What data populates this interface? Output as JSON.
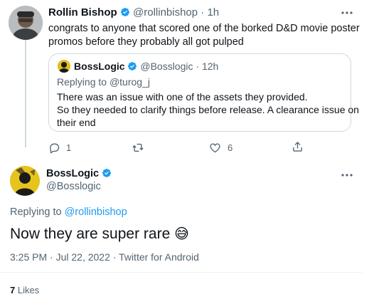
{
  "parent_tweet": {
    "author_name": "Rollin Bishop",
    "handle": "@rollinbishop",
    "time": "· 1h",
    "text_line1": "congrats to anyone that scored one of the borked D&D movie poster",
    "text_line2": "promos before they probably all got pulped",
    "quoted": {
      "author_name": "BossLogic",
      "handle": "@Bosslogic",
      "time": "· 12h",
      "replying_prefix": "Replying to ",
      "replying_handle": "@turog_j",
      "text_line1": "There was an issue with one of the assets they provided.",
      "text_line2": "So they needed to clarify things before release. A clearance issue on",
      "text_line3": "their end"
    },
    "actions": {
      "reply_count": "1",
      "retweet_count": "",
      "like_count": "6"
    }
  },
  "main_tweet": {
    "author_name": "BossLogic",
    "handle": "@Bosslogic",
    "replying_prefix": "Replying to ",
    "replying_handle": "@rollinbishop",
    "text": "Now they are super rare",
    "emoji": "😅",
    "meta": "3:25 PM · Jul 22, 2022 · Twitter for Android",
    "likes_count": "7",
    "likes_label": " Likes"
  },
  "colors": {
    "accent": "#1d9bf0",
    "muted": "#536471",
    "text": "#0f1419",
    "border": "#cfd9de"
  }
}
